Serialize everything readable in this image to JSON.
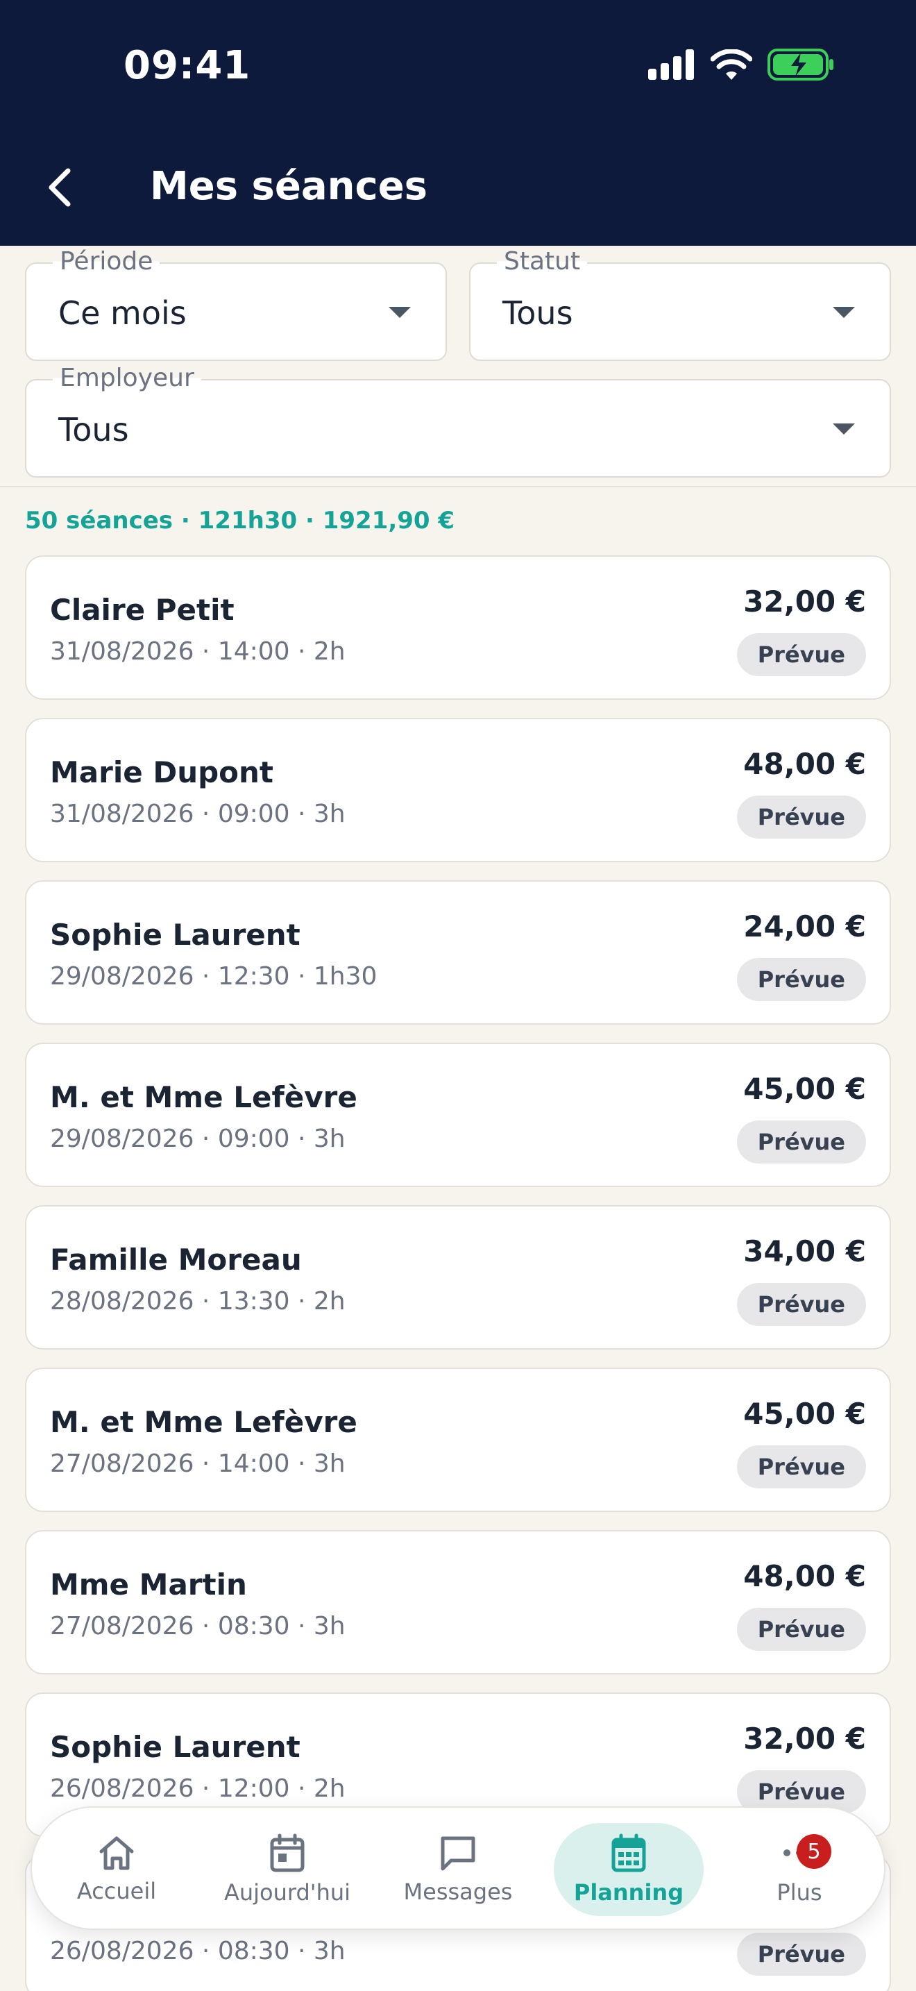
{
  "status_bar": {
    "time": "09:41"
  },
  "header": {
    "title": "Mes séances"
  },
  "filters": {
    "periode": {
      "label": "Période",
      "value": "Ce mois"
    },
    "statut": {
      "label": "Statut",
      "value": "Tous"
    },
    "employeur": {
      "label": "Employeur",
      "value": "Tous"
    }
  },
  "summary": "50 séances · 121h30 · 1921,90 €",
  "sessions": [
    {
      "name": "Claire Petit",
      "meta": "31/08/2026 · 14:00 · 2h",
      "amount": "32,00 €",
      "status": "Prévue"
    },
    {
      "name": "Marie Dupont",
      "meta": "31/08/2026 · 09:00 · 3h",
      "amount": "48,00 €",
      "status": "Prévue"
    },
    {
      "name": "Sophie Laurent",
      "meta": "29/08/2026 · 12:30 · 1h30",
      "amount": "24,00 €",
      "status": "Prévue"
    },
    {
      "name": "M. et Mme Lefèvre",
      "meta": "29/08/2026 · 09:00 · 3h",
      "amount": "45,00 €",
      "status": "Prévue"
    },
    {
      "name": "Famille Moreau",
      "meta": "28/08/2026 · 13:30 · 2h",
      "amount": "34,00 €",
      "status": "Prévue"
    },
    {
      "name": "M. et Mme Lefèvre",
      "meta": "27/08/2026 · 14:00 · 3h",
      "amount": "45,00 €",
      "status": "Prévue"
    },
    {
      "name": "Mme Martin",
      "meta": "27/08/2026 · 08:30 · 3h",
      "amount": "48,00 €",
      "status": "Prévue"
    },
    {
      "name": "Sophie Laurent",
      "meta": "26/08/2026 · 12:00 · 2h",
      "amount": "32,00 €",
      "status": "Prévue"
    },
    {
      "name": "",
      "meta": "26/08/2026 · 08:30 · 3h",
      "amount": "",
      "status": "Prévue"
    }
  ],
  "tabbar": {
    "items": [
      {
        "label": "Accueil",
        "icon": "home-icon"
      },
      {
        "label": "Aujourd'hui",
        "icon": "calendar-day-icon"
      },
      {
        "label": "Messages",
        "icon": "message-icon"
      },
      {
        "label": "Planning",
        "icon": "calendar-grid-icon",
        "active": true
      },
      {
        "label": "Plus",
        "icon": "more-icon",
        "badge": "5"
      }
    ]
  },
  "colors": {
    "header_bg": "#0e1a3b",
    "accent": "#14a396",
    "page_bg": "#f7f4ee",
    "badge_red": "#c81e1e"
  }
}
